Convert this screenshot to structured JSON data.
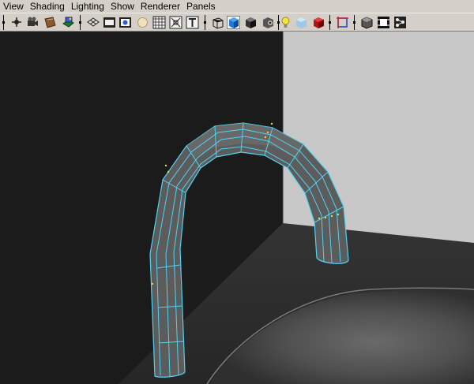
{
  "menubar": {
    "items": [
      "View",
      "Shading",
      "Lighting",
      "Show",
      "Renderer",
      "Panels"
    ]
  },
  "toolbar": {
    "icons": [
      "camera-select-icon",
      "camera-attributes-icon",
      "bookmark-icon",
      "image-plane-icon",
      "grid-icon",
      "film-gate-icon",
      "resolution-gate-icon",
      "field-chart-icon",
      "safe-action-icon",
      "safe-title-icon",
      "text-icon",
      "wireframe-icon",
      "smooth-shade-icon",
      "flat-shade-icon",
      "bounding-box-icon",
      "default-lighting-icon",
      "xray-icon",
      "hardware-texturing-icon",
      "isolate-select-icon",
      "frame-all-icon",
      "frame-selection-icon",
      "graph-icon"
    ]
  },
  "colors": {
    "ui_background": "#d4d0c8",
    "wall_dark": "#1b1b1b",
    "wall_light": "#c8c8c8",
    "floor": "#2d2d2d",
    "mesh_wire": "#4fd4f4",
    "mesh_fill": "#5c5c5c"
  }
}
